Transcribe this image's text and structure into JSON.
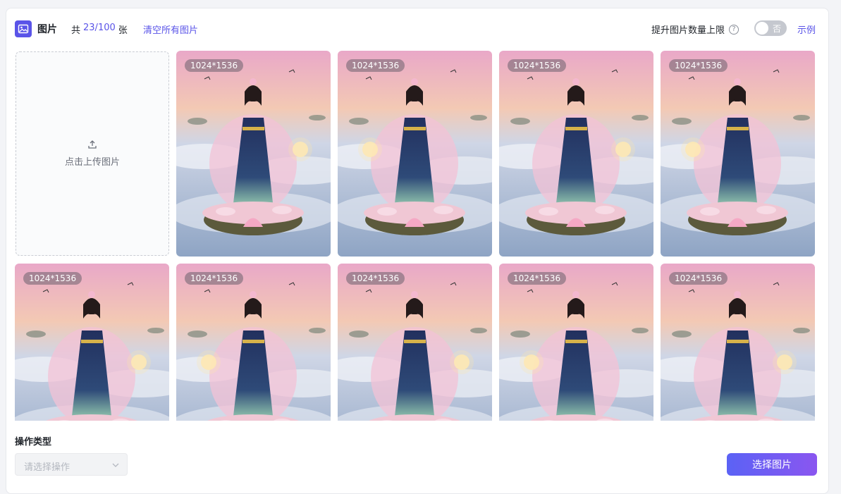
{
  "header": {
    "title": "图片",
    "count_prefix": "共",
    "count_value": "23/100",
    "count_suffix": "张",
    "clear_label": "清空所有图片",
    "limit_label": "提升图片数量上限",
    "toggle_label": "否",
    "toggle_on": false,
    "example_label": "示例",
    "accent_color": "#5a54e8"
  },
  "upload": {
    "label": "点击上传图片",
    "icon": "upload-icon"
  },
  "images": [
    {
      "size": "1024*1536"
    },
    {
      "size": "1024*1536"
    },
    {
      "size": "1024*1536"
    },
    {
      "size": "1024*1536"
    },
    {
      "size": "1024*1536"
    },
    {
      "size": "1024*1536"
    },
    {
      "size": "1024*1536"
    },
    {
      "size": "1024*1536"
    },
    {
      "size": "1024*1536"
    }
  ],
  "operation": {
    "label": "操作类型",
    "placeholder": "请选择操作"
  },
  "select_button_label": "选择图片"
}
